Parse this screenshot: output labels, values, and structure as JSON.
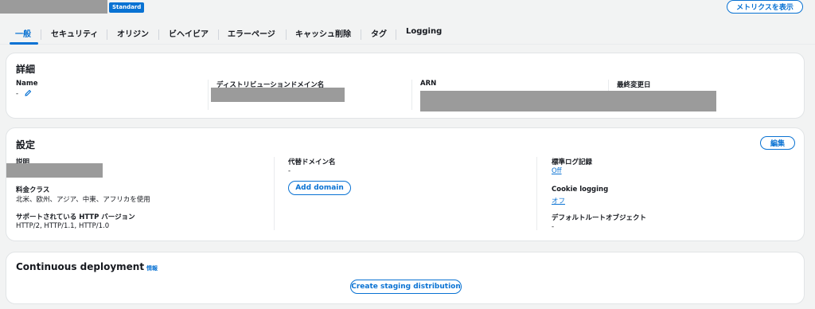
{
  "header": {
    "badge": "Standard",
    "metrics_button": "メトリクスを表示"
  },
  "tabs": [
    {
      "label": "一般",
      "active": true
    },
    {
      "label": "セキュリティ"
    },
    {
      "label": "オリジン"
    },
    {
      "label": "ビヘイビア"
    },
    {
      "label": "エラーページ"
    },
    {
      "label": "キャッシュ削除"
    },
    {
      "label": "タグ"
    },
    {
      "label": "Logging"
    }
  ],
  "details": {
    "title": "詳細",
    "name_label": "Name",
    "name_value": "-",
    "domain_label": "ディストリビューションドメイン名",
    "arn_label": "ARN",
    "last_modified_label": "最終変更日"
  },
  "settings": {
    "title": "設定",
    "edit_button": "編集",
    "description_label": "説明",
    "price_class_label": "料金クラス",
    "price_class_value": "北米、欧州、アジア、中東、アフリカを使用",
    "http_versions_label": "サポートされている HTTP バージョン",
    "http_versions_value": "HTTP/2, HTTP/1.1, HTTP/1.0",
    "alt_domain_label": "代替ドメイン名",
    "alt_domain_value": "-",
    "add_domain_button": "Add domain",
    "std_log_label": "標準ログ記録",
    "std_log_value": "Off",
    "cookie_log_label": "Cookie logging",
    "cookie_log_value": "オフ",
    "default_root_label": "デフォルトルートオブジェクト",
    "default_root_value": "-"
  },
  "continuous": {
    "title": "Continuous deployment",
    "info": "情報",
    "staging_button": "Create staging distribution"
  },
  "colors": {
    "accent": "#0972d3",
    "background": "#f2f3f3",
    "card": "#ffffff"
  }
}
